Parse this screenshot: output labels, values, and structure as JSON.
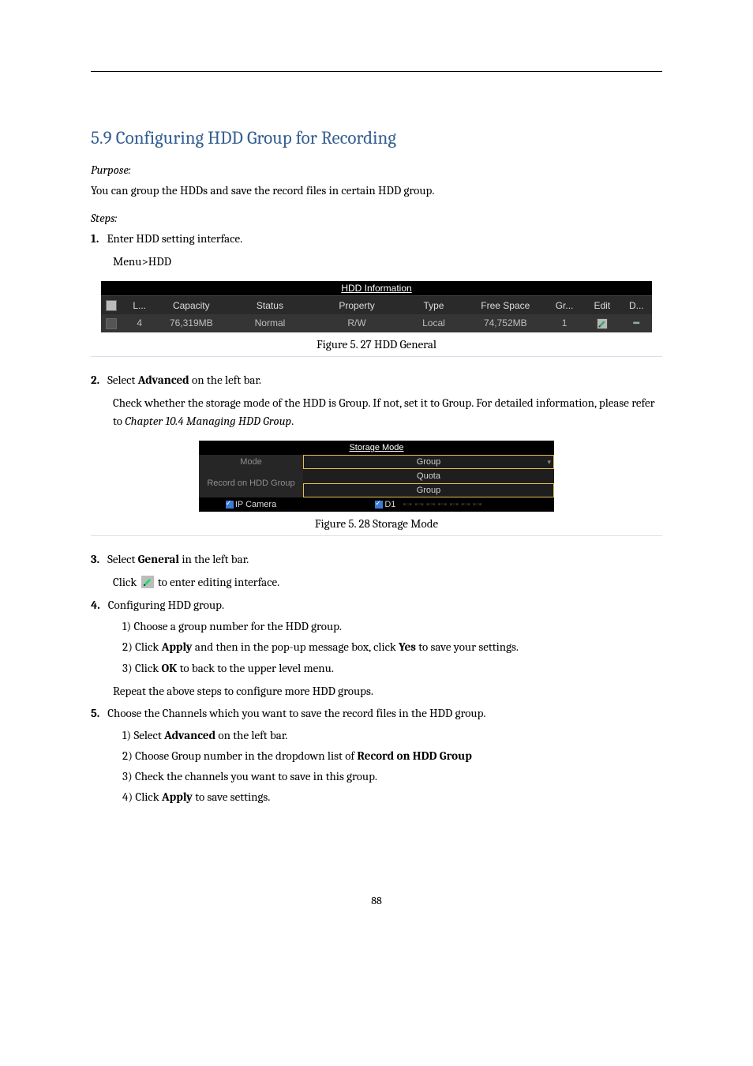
{
  "section": {
    "heading": "5.9 Configuring HDD Group for Recording",
    "purpose_label": "Purpose:",
    "purpose_text": "You can group the HDDs and save the record files in certain HDD group.",
    "steps_label": "Steps:"
  },
  "steps": {
    "s1": "Enter HDD setting interface.",
    "s1_path": "Menu>HDD",
    "s2": "Select Advanced on the left bar.",
    "s2_after": "Check whether the storage mode of the HDD is Group. If not, set it to Group. For detailed information, please refer to Chapter 10.4 Managing HDD Group.",
    "s3": "Select General in the left bar.",
    "s3_click_prefix": "Click",
    "s3_click_suffix": "to enter editing interface.",
    "s4": "Configuring HDD group.",
    "s4_1": "1) Choose a group number for the HDD group.",
    "s4_2": "2) Click Apply and then in the pop-up message box, click Yes to save your settings.",
    "s4_3": "3) Click OK to back to the upper level menu.",
    "s4_repeat": "Repeat the above steps to configure more HDD groups.",
    "s5": "Choose the Channels which you want to save the record files in the HDD group.",
    "s5_1": "1) Select Advanced on the left bar.",
    "s5_2": "2) Choose Group number in the dropdown list of Record on HDD Group",
    "s5_3": "3) Check the channels you want to save in this group.",
    "s5_4": "4) Click Apply to save settings."
  },
  "figures": {
    "f27": "Figure 5. 27 HDD General",
    "f28": "Figure 5. 28 Storage Mode"
  },
  "hdd_table": {
    "title": "HDD Information",
    "headers": {
      "l": "L...",
      "capacity": "Capacity",
      "status": "Status",
      "property": "Property",
      "type": "Type",
      "free": "Free Space",
      "gr": "Gr...",
      "edit": "Edit",
      "d": "D..."
    },
    "row": {
      "l": "4",
      "capacity": "76,319MB",
      "status": "Normal",
      "property": "R/W",
      "type": "Local",
      "free": "74,752MB",
      "gr": "1"
    }
  },
  "storage": {
    "title": "Storage Mode",
    "mode_label": "Mode",
    "mode_value": "Group",
    "rec_label": "Record on HDD Group",
    "quota": "Quota",
    "group": "Group",
    "ipcam_label": "IP Camera",
    "d1": "D1"
  },
  "page_number": "88"
}
